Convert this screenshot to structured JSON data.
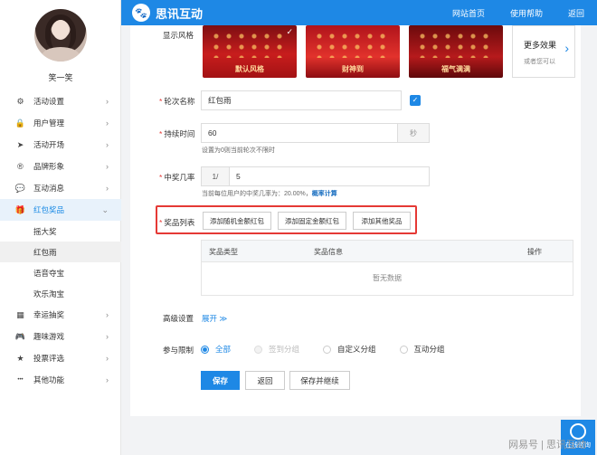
{
  "app": {
    "brand": "思讯互动",
    "logo_glyph": "🐾",
    "accent_color": "#1e88e5",
    "highlight_color": "#e53935"
  },
  "topnav": {
    "home": "网站首页",
    "help": "使用帮助",
    "back": "返回"
  },
  "user": {
    "name": "笑一笑"
  },
  "sidebar": {
    "items": [
      {
        "label": "活动设置",
        "icon": "gear-icon",
        "glyph": "⚙"
      },
      {
        "label": "用户管理",
        "icon": "lock-icon",
        "glyph": "🔒"
      },
      {
        "label": "活动开场",
        "icon": "send-icon",
        "glyph": "➤"
      },
      {
        "label": "品牌形象",
        "icon": "registered-icon",
        "glyph": "®"
      },
      {
        "label": "互动消息",
        "icon": "message-icon",
        "glyph": "💬"
      },
      {
        "label": "红包奖品",
        "icon": "gift-icon",
        "glyph": "🎁"
      },
      {
        "label": "幸运抽奖",
        "icon": "grid-icon",
        "glyph": "▦"
      },
      {
        "label": "趣味游戏",
        "icon": "gamepad-icon",
        "glyph": "🎮"
      },
      {
        "label": "投票评选",
        "icon": "star-icon",
        "glyph": "★"
      },
      {
        "label": "其他功能",
        "icon": "more-icon",
        "glyph": "•••"
      }
    ],
    "sub_items": [
      "摇大奖",
      "红包雨",
      "语音夺宝",
      "欢乐淘宝"
    ]
  },
  "form": {
    "style_label": "显示风格",
    "styles": [
      {
        "caption": "默认风格"
      },
      {
        "caption": "财神到"
      },
      {
        "caption": "福气满满"
      }
    ],
    "more_effects": "更多效果",
    "more_hint": "或者您可以",
    "round_name_label": "轮次名称",
    "round_name_value": "红包雨",
    "duration_label": "持续时间",
    "duration_value": "60",
    "duration_unit": "秒",
    "duration_hint": "设置为0则当前轮次不限时",
    "win_rate_label": "中奖几率",
    "win_rate_prefix": "1/",
    "win_rate_value": "5",
    "win_rate_hint": "当前每位用户的中奖几率为：20.00%，",
    "win_rate_link": "概率计算",
    "prize_label": "奖品列表",
    "add_random": "添加随机金额红包",
    "add_fixed": "添加固定金额红包",
    "add_other": "添加其他奖品",
    "table_headers": [
      "奖品类型",
      "奖品信息",
      "操作"
    ],
    "table_empty": "暂无数据",
    "advanced_label": "高级设置",
    "expand_link": "展开",
    "expand_glyph": "≫",
    "limit_label": "参与限制",
    "limit_options": [
      "全部",
      "签到分组",
      "自定义分组",
      "互动分组"
    ],
    "save": "保存",
    "back": "返回",
    "save_continue": "保存并继续"
  },
  "widget": {
    "label": "在线咨询"
  },
  "watermark": "网易号 | 思讯互动"
}
